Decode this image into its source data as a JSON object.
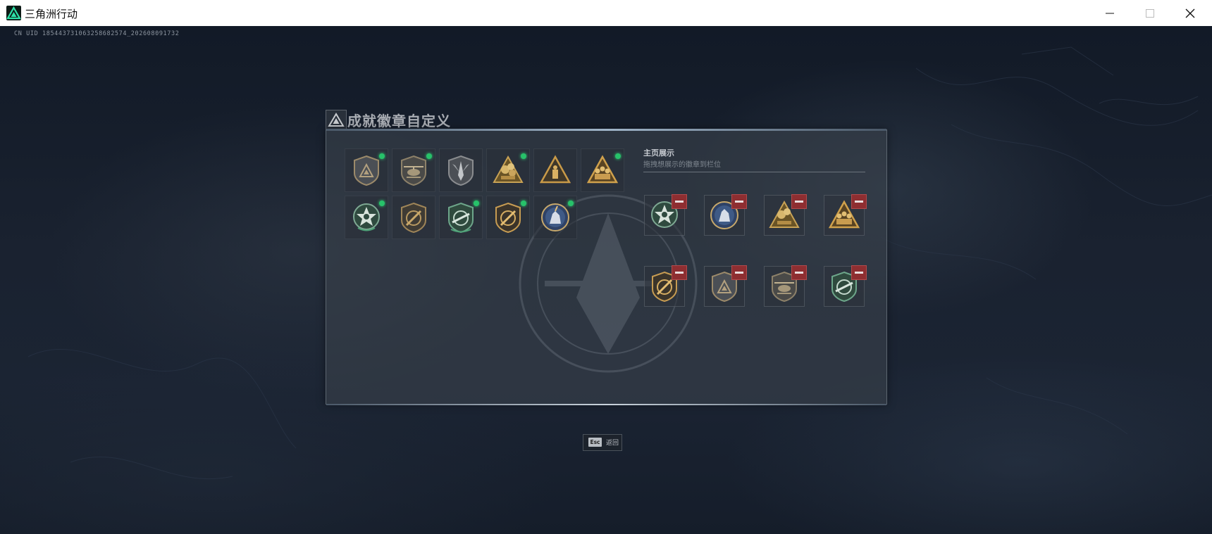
{
  "window": {
    "title": "三角洲行动"
  },
  "uid_text": "CN UID 185443731063258682574_202608091732",
  "panel": {
    "title": "成就徽章自定义",
    "display_section": {
      "title": "主页展示",
      "hint": "拖拽想展示的徽章到栏位"
    }
  },
  "footer": {
    "esc_key": "Esc",
    "esc_label": "返回"
  },
  "colors": {
    "new_indicator": "#27c26a",
    "remove_button": "#8e2e31",
    "panel_bg": "#3a424c"
  }
}
